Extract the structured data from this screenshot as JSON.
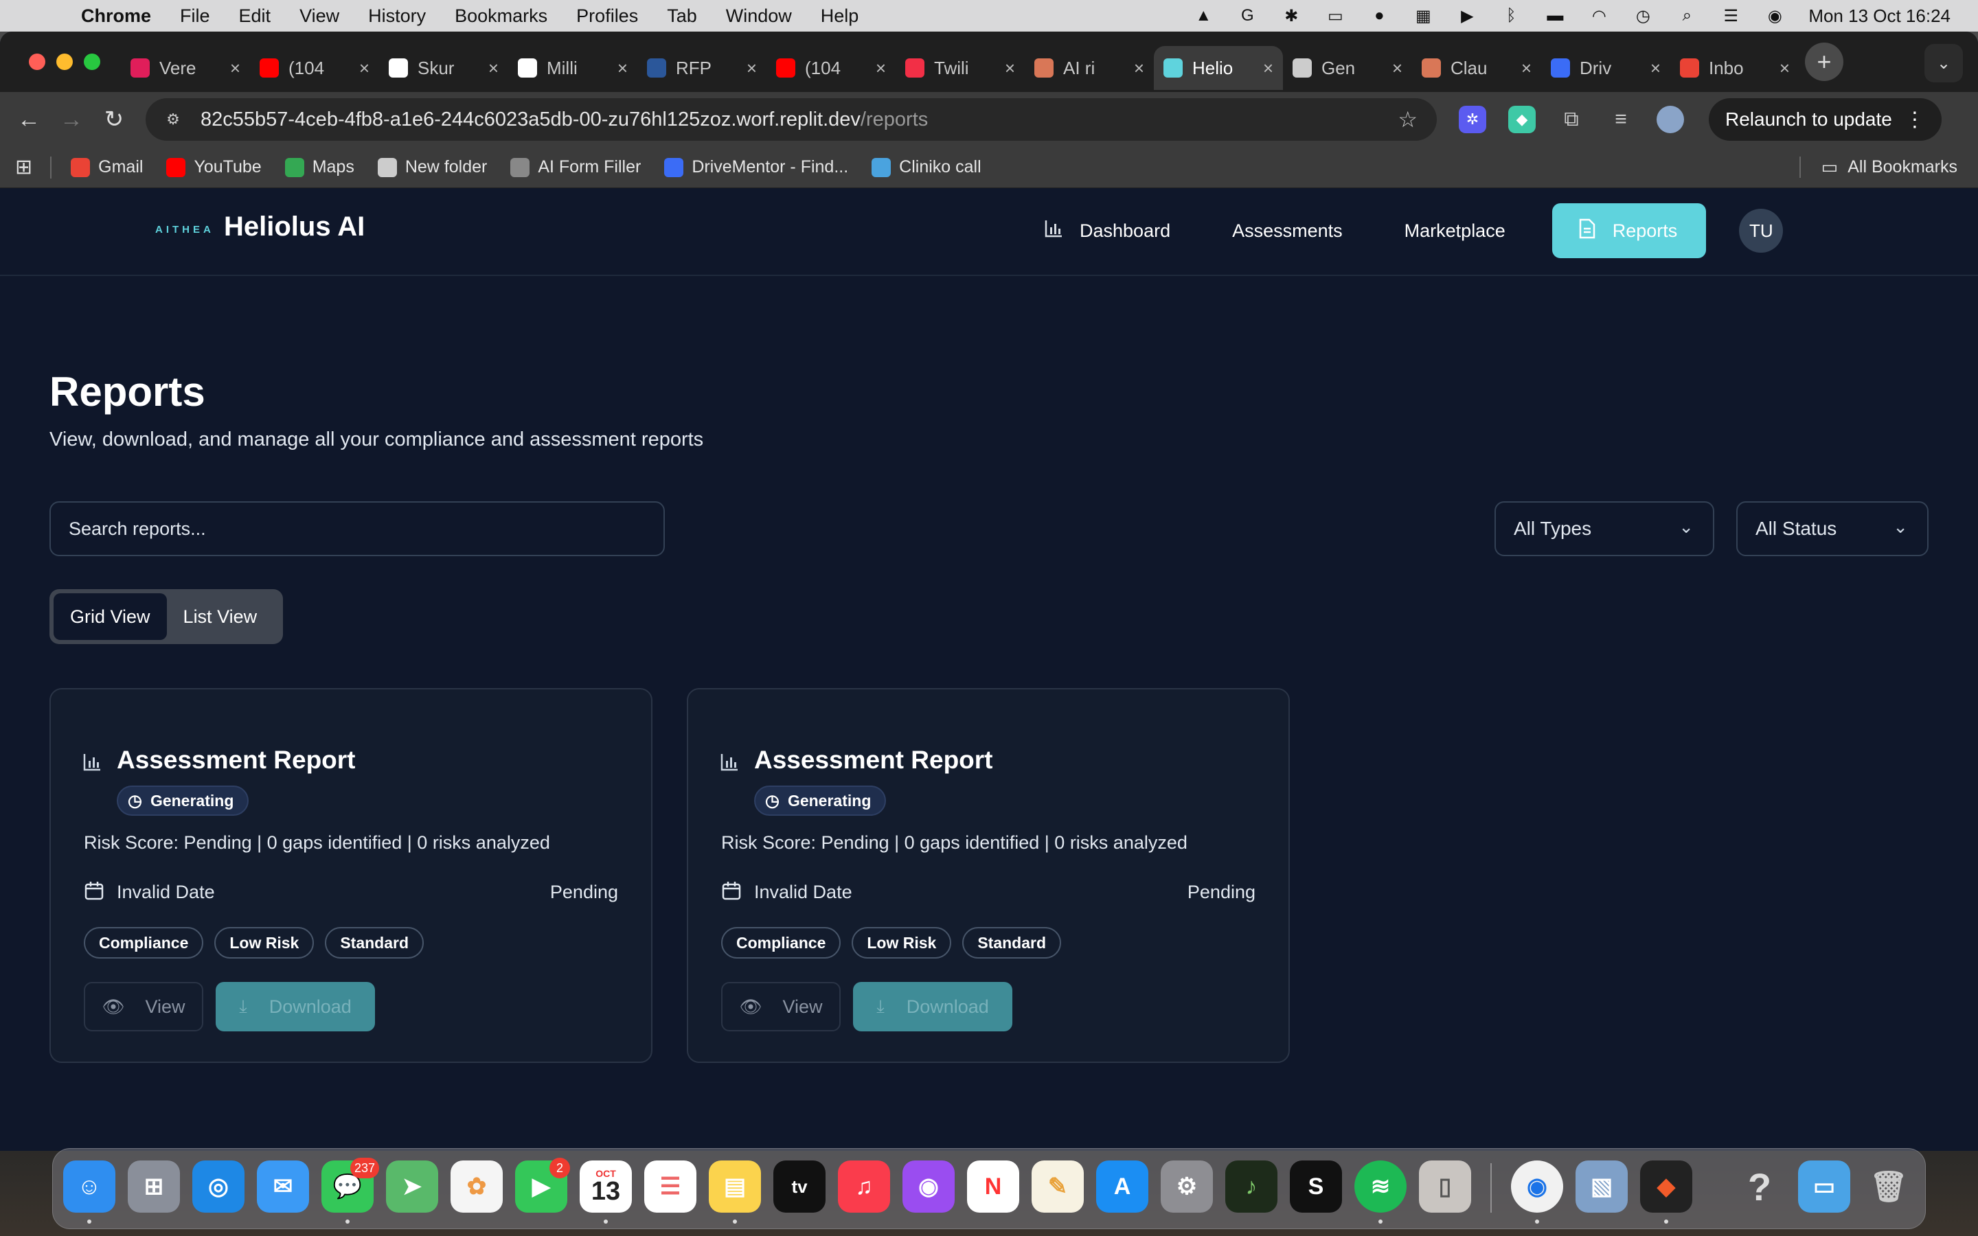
{
  "menubar": {
    "app_name": "Chrome",
    "items": [
      "File",
      "Edit",
      "View",
      "History",
      "Bookmarks",
      "Profiles",
      "Tab",
      "Window",
      "Help"
    ],
    "clock": "Mon 13 Oct  16:24"
  },
  "browser": {
    "tabs": [
      {
        "label": "Vere",
        "color": "#e01e5a",
        "icon": "slack-icon"
      },
      {
        "label": "(104",
        "color": "#ff0000",
        "icon": "youtube-icon"
      },
      {
        "label": "Skur",
        "color": "#ffffff",
        "icon": "skur-icon"
      },
      {
        "label": "Milli",
        "color": "#ffffff",
        "icon": "milli-icon"
      },
      {
        "label": "RFP",
        "color": "#2b579a",
        "icon": "word-icon"
      },
      {
        "label": "(104",
        "color": "#ff0000",
        "icon": "youtube-icon"
      },
      {
        "label": "Twili",
        "color": "#f22f46",
        "icon": "twilio-icon"
      },
      {
        "label": "AI ri",
        "color": "#d97757",
        "icon": "claude-icon"
      },
      {
        "label": "Helio",
        "color": "#5fd3dd",
        "icon": "heliolus-icon"
      },
      {
        "label": "Gen",
        "color": "#cccccc",
        "icon": "openai-icon"
      },
      {
        "label": "Clau",
        "color": "#d97757",
        "icon": "claude-icon"
      },
      {
        "label": "Driv",
        "color": "#3b6cf6",
        "icon": "drivementor-icon"
      },
      {
        "label": "Inbo",
        "color": "#ea4335",
        "icon": "gmail-icon"
      }
    ],
    "active_tab_index": 8,
    "url_host": "82c55b57-4ceb-4fb8-a1e6-244c6023a5db-00-zu76hl125zoz.worf.replit.dev",
    "url_path": "/reports",
    "relaunch_label": "Relaunch to update",
    "bookmarks": [
      {
        "label": "Gmail",
        "color": "#ea4335"
      },
      {
        "label": "YouTube",
        "color": "#ff0000"
      },
      {
        "label": "Maps",
        "color": "#34a853"
      },
      {
        "label": "New folder",
        "color": "#cccccc"
      },
      {
        "label": "AI Form Filler",
        "color": "#888888"
      },
      {
        "label": "DriveMentor - Find...",
        "color": "#3b6cf6"
      },
      {
        "label": "Cliniko call",
        "color": "#4aa3df"
      }
    ],
    "all_bookmarks_label": "All Bookmarks"
  },
  "app": {
    "brand_mark": "AITHEA",
    "brand_name": "Heliolus AI",
    "nav": [
      "Dashboard",
      "Assessments",
      "Marketplace",
      "Reports"
    ],
    "active_nav": "Reports",
    "avatar_initials": "TU",
    "accent_color": "#5fd3dd"
  },
  "reports_page": {
    "title": "Reports",
    "subtitle": "View, download, and manage all your compliance and assessment reports",
    "search_placeholder": "Search reports...",
    "type_filter": "All Types",
    "status_filter": "All Status",
    "view_toggle": {
      "grid": "Grid View",
      "list": "List View",
      "active": "Grid View"
    },
    "cards": [
      {
        "title": "Assessment Report",
        "badge": "Generating",
        "description": "Risk Score: Pending | 0 gaps identified | 0 risks analyzed",
        "date": "Invalid Date",
        "status": "Pending",
        "tags": [
          "Compliance",
          "Low Risk",
          "Standard"
        ],
        "view_label": "View",
        "download_label": "Download"
      },
      {
        "title": "Assessment Report",
        "badge": "Generating",
        "description": "Risk Score: Pending | 0 gaps identified | 0 risks analyzed",
        "date": "Invalid Date",
        "status": "Pending",
        "tags": [
          "Compliance",
          "Low Risk",
          "Standard"
        ],
        "view_label": "View",
        "download_label": "Download"
      }
    ]
  },
  "dock": {
    "messages_badge": "237",
    "facetime_badge": "2",
    "calendar_month": "OCT",
    "calendar_day": "13",
    "tv_label": "tv",
    "help_glyph": "?"
  }
}
